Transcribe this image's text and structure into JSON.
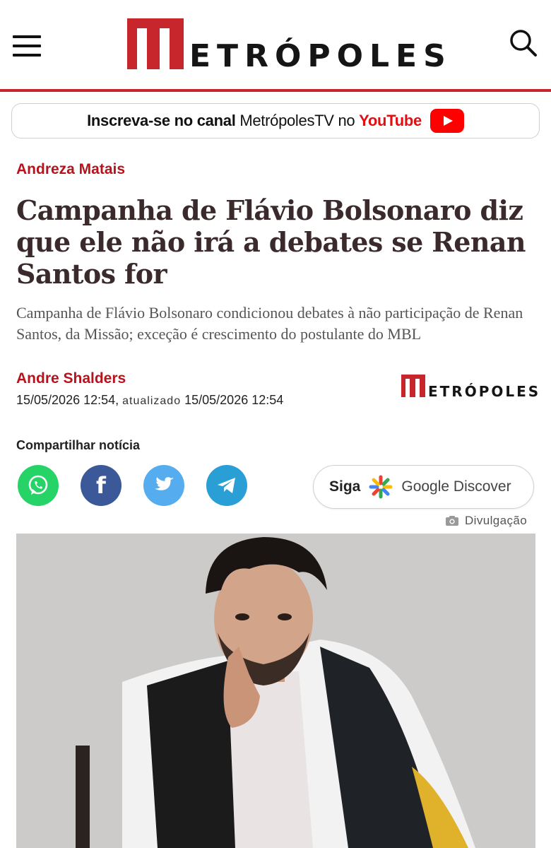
{
  "header": {
    "logo_text": "ETRÓPOLES",
    "menu_icon": "hamburger-menu-icon",
    "search_icon": "search-icon",
    "accent": "#c6262c"
  },
  "youtube_banner": {
    "prefix": "Inscreva-se no canal",
    "channel": "MetrópolesTV",
    "connector": "no",
    "platform": "YouTube"
  },
  "article": {
    "column": "Andreza Matais",
    "title": "Campanha de Flávio Bolsonaro diz que ele não irá a debates se Renan Santos for",
    "subtitle": "Campanha de Flávio Bolsonaro condicionou debates à não participação de Renan Santos, da Missão; exceção é crescimento do postulante do MBL",
    "author": "Andre Shalders",
    "published": "15/05/2026 12:54,",
    "updated_label": "atualizado",
    "updated": "15/05/2026 12:54",
    "small_logo_text": "ETRÓPOLES"
  },
  "share": {
    "label": "Compartilhar notícia",
    "buttons": [
      "whatsapp",
      "facebook",
      "twitter",
      "telegram"
    ],
    "facebook_glyph": "f"
  },
  "discover": {
    "siga": "Siga",
    "label": "Google Discover"
  },
  "photo": {
    "credit": "Divulgação"
  }
}
